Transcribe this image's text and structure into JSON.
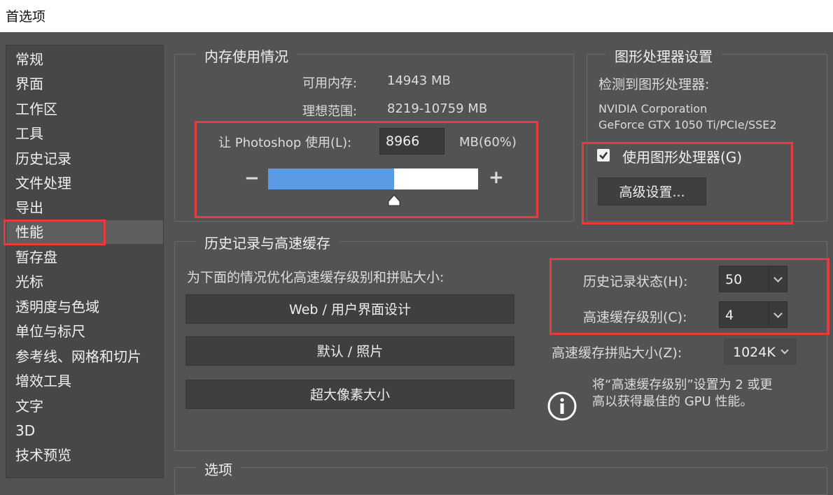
{
  "window": {
    "title": "首选项"
  },
  "sidebar": {
    "items": [
      {
        "label": "常规"
      },
      {
        "label": "界面"
      },
      {
        "label": "工作区"
      },
      {
        "label": "工具"
      },
      {
        "label": "历史记录"
      },
      {
        "label": "文件处理"
      },
      {
        "label": "导出"
      },
      {
        "label": "性能"
      },
      {
        "label": "暂存盘"
      },
      {
        "label": "光标"
      },
      {
        "label": "透明度与色域"
      },
      {
        "label": "单位与标尺"
      },
      {
        "label": "参考线、网格和切片"
      },
      {
        "label": "增效工具"
      },
      {
        "label": "文字"
      },
      {
        "label": "3D"
      },
      {
        "label": "技术预览"
      }
    ],
    "selected": "性能"
  },
  "memory": {
    "title": "内存使用情况",
    "available_label": "可用内存:",
    "available_value": "14943 MB",
    "ideal_label": "理想范围:",
    "ideal_value": "8219-10759 MB",
    "use_label": "让 Photoshop 使用(L):",
    "use_value": "8966",
    "use_unit": "MB(60%)",
    "slider_fraction": 0.6,
    "minus": "−",
    "plus": "+"
  },
  "gpu": {
    "title": "图形处理器设置",
    "detected_label": "检测到图形处理器:",
    "vendor": "NVIDIA Corporation",
    "model": "GeForce GTX 1050 Ti/PCIe/SSE2",
    "use_gpu_label": "使用图形处理器(G)",
    "use_gpu_checked": true,
    "advanced_button": "高级设置..."
  },
  "history_cache": {
    "title": "历史记录与高速缓存",
    "optimize_label": "为下面的情况优化高速缓存级别和拼贴大小:",
    "buttons": [
      "Web / 用户界面设计",
      "默认 / 照片",
      "超大像素大小"
    ],
    "history_states_label": "历史记录状态(H):",
    "history_states_value": "50",
    "cache_levels_label": "高速缓存级别(C):",
    "cache_levels_value": "4",
    "tile_size_label": "高速缓存拼贴大小(Z):",
    "tile_size_value": "1024K",
    "info_line1": "将“高速缓存级别”设置为 2 或更",
    "info_line2": "高以获得最佳的 GPU 性能。"
  },
  "options": {
    "title": "选项"
  },
  "colors": {
    "highlight": "#e63c3c",
    "slider_fill": "#5b9be6",
    "panel": "#535353"
  }
}
